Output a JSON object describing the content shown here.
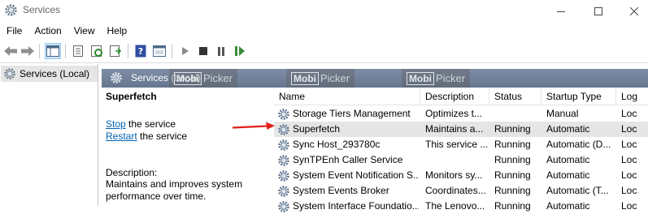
{
  "window": {
    "title": "Services"
  },
  "menu": [
    "File",
    "Action",
    "View",
    "Help"
  ],
  "toolbar": {
    "icons": [
      "back-arrow-icon",
      "forward-arrow-icon",
      "show-hide-tree-icon",
      "properties-icon",
      "refresh-icon",
      "export-list-icon",
      "help-icon",
      "console-icon",
      "start-service-icon",
      "stop-service-icon",
      "pause-service-icon",
      "restart-service-icon"
    ]
  },
  "tree": {
    "root_label": "Services (Local)"
  },
  "banner": {
    "label": "Services (Local)"
  },
  "watermark": {
    "brand_a": "Mobi",
    "brand_b": "Picker"
  },
  "detail": {
    "service_name": "Superfetch",
    "stop_link": "Stop",
    "stop_suffix": " the service",
    "restart_link": "Restart",
    "restart_suffix": " the service",
    "description_heading": "Description:",
    "description_text": "Maintains and improves system performance over time."
  },
  "columns": {
    "name": "Name",
    "description": "Description",
    "status": "Status",
    "startup_type": "Startup Type",
    "log_on_as": "Log"
  },
  "rows": [
    {
      "name": "Storage Tiers Management",
      "description": "Optimizes t...",
      "status": "",
      "startup": "Manual",
      "logon": "Loc"
    },
    {
      "name": "Superfetch",
      "description": "Maintains a...",
      "status": "Running",
      "startup": "Automatic",
      "logon": "Loc"
    },
    {
      "name": "Sync Host_293780c",
      "description": "This service ...",
      "status": "Running",
      "startup": "Automatic (D...",
      "logon": "Loc"
    },
    {
      "name": "SynTPEnh Caller Service",
      "description": "",
      "status": "Running",
      "startup": "Automatic",
      "logon": "Loc"
    },
    {
      "name": "System Event Notification S...",
      "description": "Monitors sy...",
      "status": "Running",
      "startup": "Automatic",
      "logon": "Loc"
    },
    {
      "name": "System Events Broker",
      "description": "Coordinates...",
      "status": "Running",
      "startup": "Automatic (T...",
      "logon": "Loc"
    },
    {
      "name": "System Interface Foundatio...",
      "description": "The Lenovo...",
      "status": "Running",
      "startup": "Automatic",
      "logon": "Loc"
    }
  ],
  "colors": {
    "selection": "#e5e5e5",
    "link": "#0063b1",
    "banner": "#6b7b93",
    "arrow": "#e0201b"
  }
}
